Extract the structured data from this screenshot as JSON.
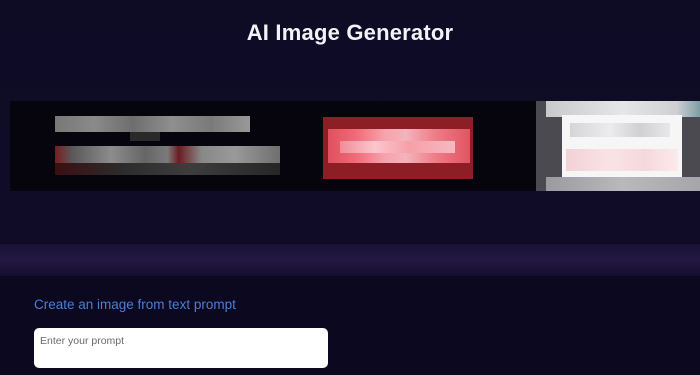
{
  "header": {
    "title": "AI Image Generator"
  },
  "banner": {
    "image": "pixelated-ad-banner"
  },
  "generator": {
    "heading": "Create an image from text prompt",
    "prompt_placeholder": "Enter your prompt",
    "prompt_value": ""
  },
  "colors": {
    "background": "#0d0a22",
    "heading_accent": "#4a7fd4",
    "banner_button": "#e0505e"
  }
}
